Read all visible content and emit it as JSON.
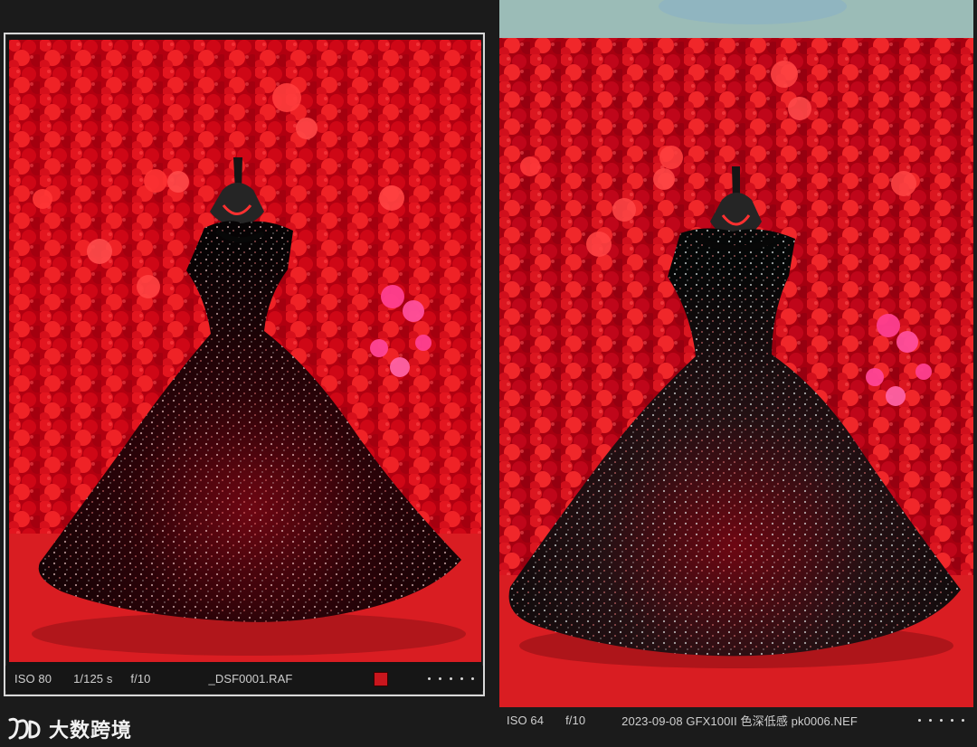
{
  "theme": {
    "background": "#1b1b1b",
    "panel_border": "#d8d8d8",
    "accent_red": "#c9161d",
    "flower_red": "#d6161d",
    "pink_flowers": "#ff3f8f",
    "floor_red": "#d91d22",
    "left_wall": "#8f8f98",
    "right_wall": "#9bbcb7"
  },
  "left_image": {
    "iso": "ISO 80",
    "shutter": "1/125 s",
    "aperture": "f/10",
    "filename": "_DSF0001.RAF",
    "flag_color": "#c9161d"
  },
  "right_image": {
    "iso": "ISO 64",
    "aperture": "f/10",
    "filename": "2023-09-08 GFX100II 色深低感 pk0006.NEF"
  },
  "watermark": {
    "logo_icon": "dsk-logo-icon",
    "text": "大数跨境"
  }
}
